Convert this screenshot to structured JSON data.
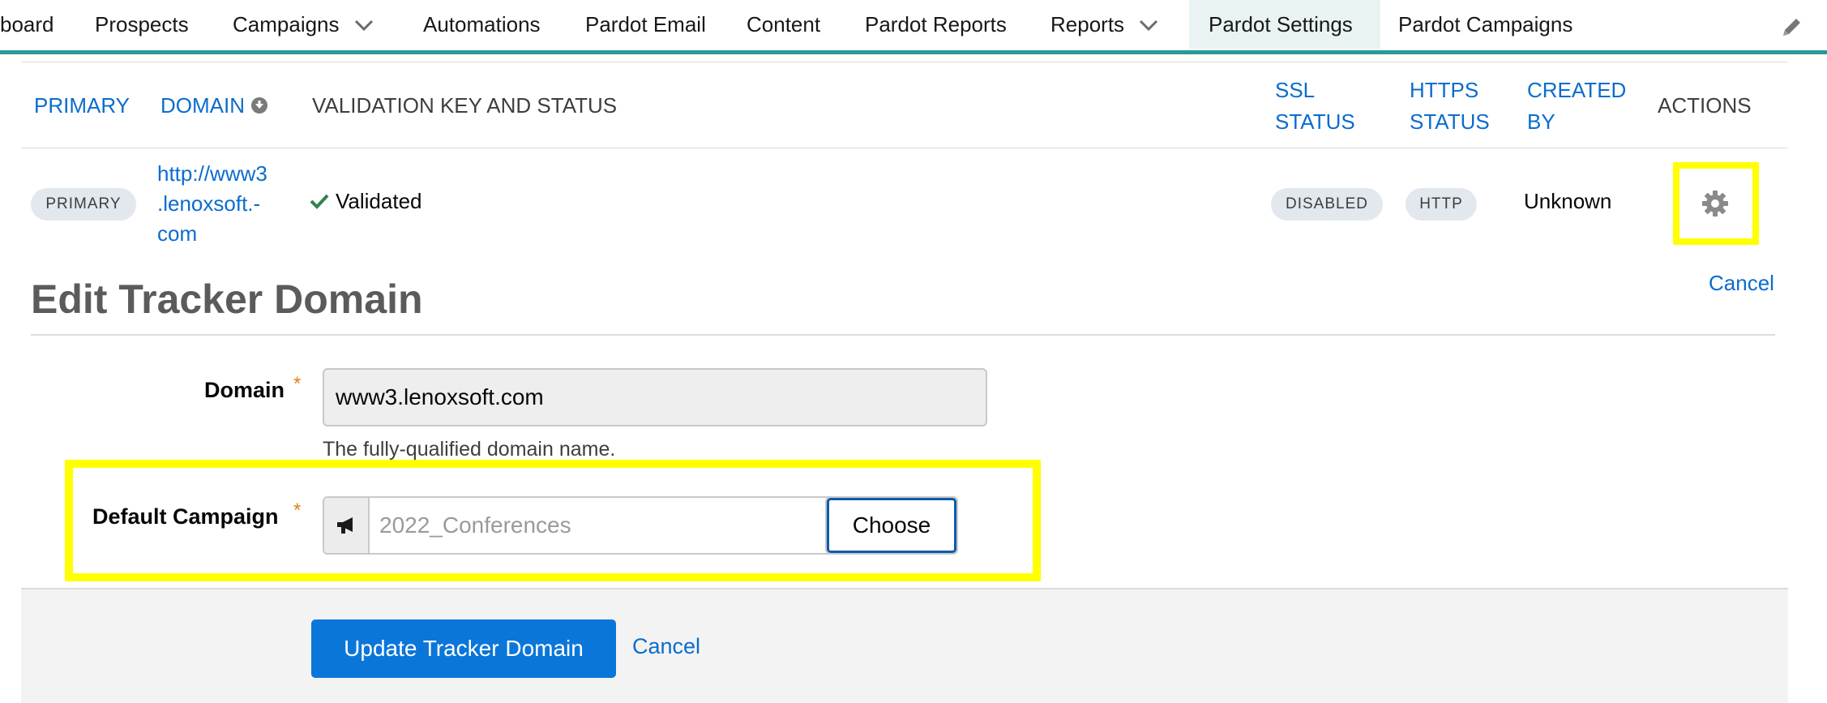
{
  "nav": {
    "items": [
      "board",
      "Prospects",
      "Campaigns",
      "Automations",
      "Pardot Email",
      "Content",
      "Pardot Reports",
      "Reports",
      "Pardot Settings",
      "Pardot Campaigns"
    ],
    "active": "Pardot Settings"
  },
  "table": {
    "headers": {
      "primary": "PRIMARY",
      "domain": "DOMAIN",
      "validation": "VALIDATION KEY AND STATUS",
      "ssl_line1": "SSL",
      "ssl_line2": "STATUS",
      "https_line1": "HTTPS",
      "https_line2": "STATUS",
      "created_line1": "CREATED",
      "created_line2": "BY",
      "actions": "ACTIONS"
    },
    "row": {
      "primary_badge": "PRIMARY",
      "domain_line1": "http://www3",
      "domain_line2": ".lenoxsoft.-",
      "domain_line3": "com",
      "validation": "Validated",
      "ssl": "DISABLED",
      "https": "HTTP",
      "created_by": "Unknown"
    }
  },
  "edit": {
    "cancel_top": "Cancel",
    "title": "Edit Tracker Domain",
    "domain_label": "Domain",
    "domain_value": "www3.lenoxsoft.com",
    "domain_help": "The fully-qualified domain name.",
    "campaign_label": "Default Campaign",
    "campaign_value": "2022_Conferences",
    "choose": "Choose",
    "required_mark": "*",
    "update": "Update Tracker Domain",
    "cancel_bottom": "Cancel"
  },
  "colors": {
    "accent": "#2a9a98",
    "link": "#0b6cce",
    "highlight": "#ffff00",
    "primary_button": "#0b76d9"
  }
}
